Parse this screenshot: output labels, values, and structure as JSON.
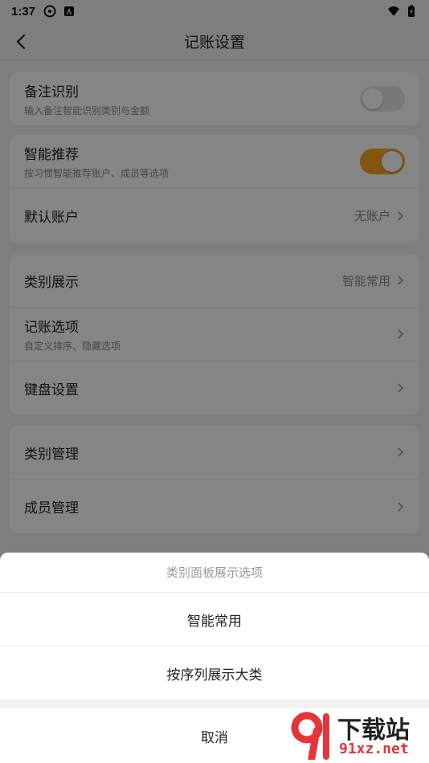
{
  "status_bar": {
    "time": "1:37",
    "left_icons": [
      "android-system-icon",
      "accessibility-a-icon"
    ],
    "right_icons": [
      "wifi-icon",
      "battery-icon"
    ]
  },
  "header": {
    "title": "记账设置"
  },
  "settings": {
    "group1": {
      "note_recognition": {
        "label": "备注识别",
        "sub": "输入备注智能识别类别与金额",
        "toggle": "off"
      }
    },
    "group2": {
      "smart_recommend": {
        "label": "智能推荐",
        "sub": "按习惯智能推荐账户、成员等选项",
        "toggle": "on"
      },
      "default_account": {
        "label": "默认账户",
        "value": "无账户"
      }
    },
    "group3": {
      "category_display": {
        "label": "类别展示",
        "value": "智能常用"
      },
      "bookkeeping_options": {
        "label": "记账选项",
        "sub": "自定义排序、隐藏选项"
      },
      "keyboard_settings": {
        "label": "键盘设置"
      }
    },
    "group4": {
      "category_management": {
        "label": "类别管理"
      },
      "member_management": {
        "label": "成员管理"
      }
    }
  },
  "bottom_sheet": {
    "title": "类别面板展示选项",
    "options": [
      "智能常用",
      "按序列展示大类"
    ],
    "cancel": "取消"
  },
  "watermark": {
    "text_big": "下载站",
    "text_small": "91xz.net",
    "logo_text": "9"
  },
  "colors": {
    "accent": "#f5a623",
    "watermark_red": "#e5353a"
  }
}
